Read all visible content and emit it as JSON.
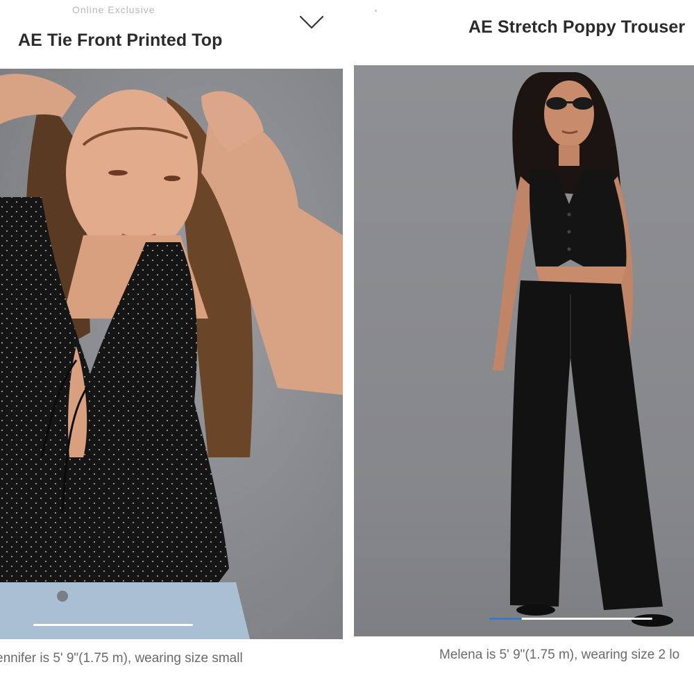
{
  "header": {
    "faded_label": "Online Exclusive",
    "chevron_icon": "chevron-down-icon"
  },
  "left_product": {
    "title": "AE Tie Front Printed Top",
    "caption": "ennifer is 5' 9\"(1.75 m), wearing size small",
    "image_icon": "model-photo-tie-front-top",
    "scroll_progress": 0.4
  },
  "right_product": {
    "title": "AE Stretch Poppy Trouser",
    "caption": "Melena is 5' 9\"(1.75 m), wearing size 2 lo",
    "image_icon": "model-photo-poppy-trouser",
    "scroll_progress": 0.2
  },
  "colors": {
    "scroll_thumb": "#3a78c9",
    "scroll_track": "#ffffff",
    "backdrop": "#8a8b8e",
    "garment": "#141414"
  }
}
